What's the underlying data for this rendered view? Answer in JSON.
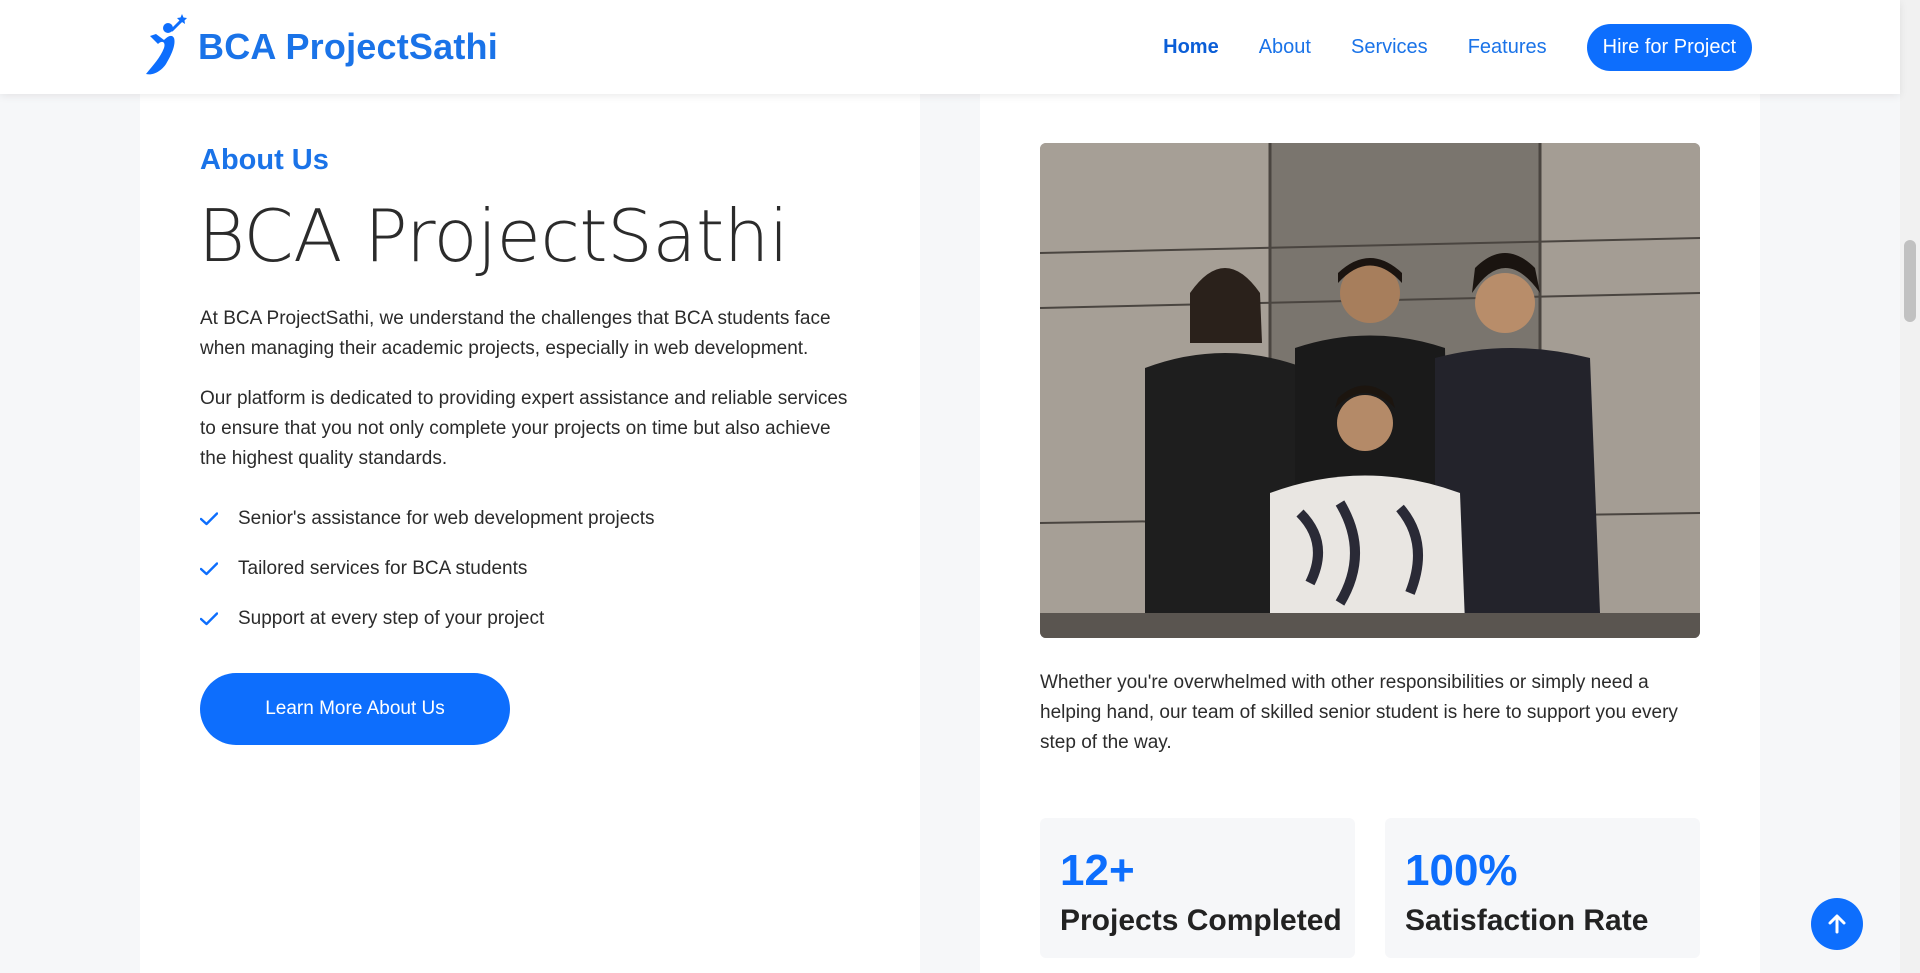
{
  "header": {
    "brand": "BCA ProjectSathi",
    "nav": [
      "Home",
      "About",
      "Services",
      "Features"
    ],
    "cta": "Hire for Project"
  },
  "about": {
    "label": "About Us",
    "title": "BCA ProjectSathi",
    "paragraph1": "At BCA ProjectSathi, we understand the challenges that BCA students face when managing their academic projects, especially in web development.",
    "paragraph2": "Our platform is dedicated to providing expert assistance and reliable services to ensure that you not only complete your projects on time but also achieve the highest quality standards.",
    "checklist": [
      "Senior's assistance for web development projects",
      "Tailored services for BCA students",
      "Support at every step of your project"
    ],
    "button": "Learn More About Us"
  },
  "right": {
    "photo_alt": "Team of four students posing in front of a wooden wall",
    "paragraph": "Whether you're overwhelmed with other responsibilities or simply need a helping hand, our team of skilled senior student is here to support you every step of the way.",
    "stats": [
      {
        "value": "12+",
        "label": "Projects Completed"
      },
      {
        "value": "100%",
        "label": "Satisfaction Rate"
      }
    ]
  },
  "colors": {
    "accent": "#0d6efd",
    "brand": "#1a73e8",
    "background": "#f6f7f9",
    "text": "#2b2b2b"
  },
  "icons": {
    "logo": "runner-star-logo-icon",
    "check": "check-icon",
    "back_to_top": "arrow-up-icon"
  }
}
